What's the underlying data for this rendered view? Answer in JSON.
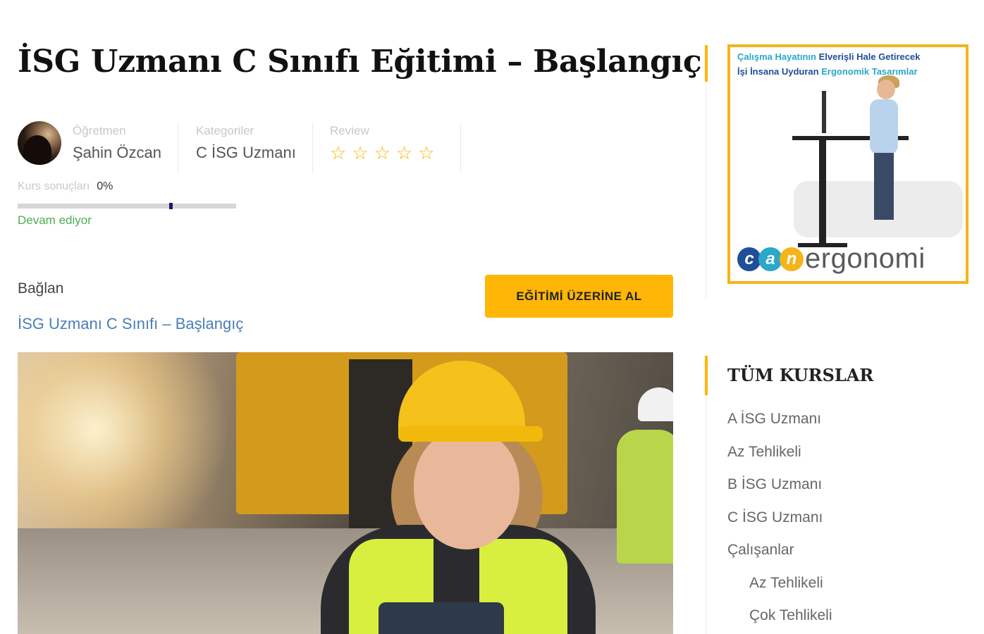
{
  "course": {
    "title": "İSG Uzmanı C Sınıfı Eğitimi – Başlangıç"
  },
  "meta": {
    "teacher": {
      "label": "Öğretmen",
      "value": "Şahin Özcan"
    },
    "category": {
      "label": "Kategoriler",
      "value": "C İSG Uzmanı"
    },
    "review": {
      "label": "Review",
      "stars": 5,
      "rating": 0
    }
  },
  "progress": {
    "label": "Kurs sonuçları",
    "percent_text": "0%",
    "value": 0,
    "status": "Devam ediyor"
  },
  "connect": {
    "title": "Bağlan",
    "link": "İSG Uzmanı C Sınıfı – Başlangıç"
  },
  "enroll_button": "EĞİTİMİ ÜZERİNE AL",
  "ad": {
    "line1_a": "Çalışma Hayatının",
    "line1_b": "Elverişli Hale Getirecek",
    "line2_a": "İşi İnsana Uyduran",
    "line2_b": "Ergonomik Tasarımlar",
    "logo_letters": [
      "c",
      "a",
      "n"
    ],
    "logo_word": "ergonomi"
  },
  "sidebar": {
    "title": "TÜM KURSLAR",
    "items": [
      {
        "label": "A İSG Uzmanı",
        "sub": false
      },
      {
        "label": "Az Tehlikeli",
        "sub": false
      },
      {
        "label": "B İSG Uzmanı",
        "sub": false
      },
      {
        "label": "C İSG Uzmanı",
        "sub": false
      },
      {
        "label": "Çalışanlar",
        "sub": false
      },
      {
        "label": "Az Tehlikeli",
        "sub": true
      },
      {
        "label": "Çok Tehlikeli",
        "sub": true
      }
    ]
  },
  "colors": {
    "accent": "#ffb606",
    "link": "#4a7eb8",
    "status": "#4caf50",
    "star": "#f2b705"
  },
  "icons": {
    "star": "star-outline-icon"
  }
}
